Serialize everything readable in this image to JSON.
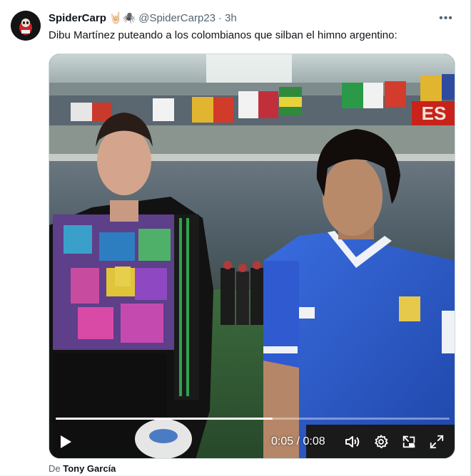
{
  "tweet": {
    "author_name": "SpiderCarp",
    "author_emojis": "🤘🏻🕷️",
    "handle": "@SpiderCarp23",
    "separator": "·",
    "time": "3h",
    "more_label": "•••",
    "text": "Dibu Martínez puteando a los colombianos que silban el himno argentino:"
  },
  "video": {
    "time_display": "0:05 / 0:08",
    "progress": 0.55,
    "scoreboard_text": "ES"
  },
  "credit": {
    "prefix": "De",
    "name": "Tony García"
  },
  "colors": {
    "text_primary": "#0f1419",
    "text_secondary": "#536471",
    "border": "#cfd9de",
    "jersey_blue": "#2a5bd0"
  },
  "icons": [
    "more-icon",
    "play-icon",
    "volume-icon",
    "settings-icon",
    "pip-icon",
    "fullscreen-icon"
  ]
}
